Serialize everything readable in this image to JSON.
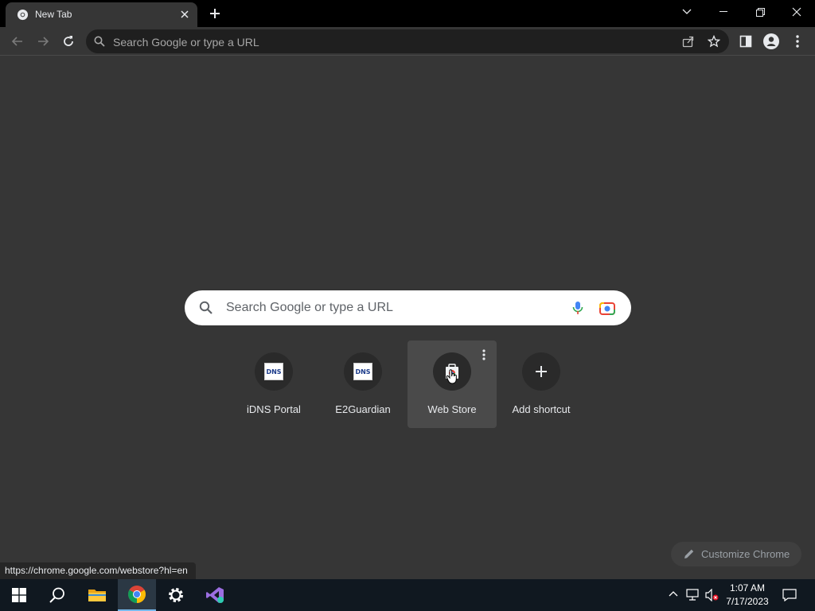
{
  "tab": {
    "title": "New Tab"
  },
  "omnibox": {
    "placeholder": "Search Google or type a URL"
  },
  "ntp_search": {
    "placeholder": "Search Google or type a URL"
  },
  "shortcuts": [
    {
      "label": "iDNS Portal",
      "icon": "idns-icon"
    },
    {
      "label": "E2Guardian",
      "icon": "idns-icon"
    },
    {
      "label": "Web Store",
      "icon": "webstore-icon"
    },
    {
      "label": "Add shortcut",
      "icon": "plus-icon"
    }
  ],
  "customize_label": "Customize Chrome",
  "status_url": "https://chrome.google.com/webstore?hl=en",
  "clock": {
    "time": "1:07 AM",
    "date": "7/17/2023"
  },
  "colors": {
    "tabstrip": "#000000",
    "toolbar": "#363636",
    "ntp_bg": "#363636",
    "taskbar": "#101820"
  }
}
